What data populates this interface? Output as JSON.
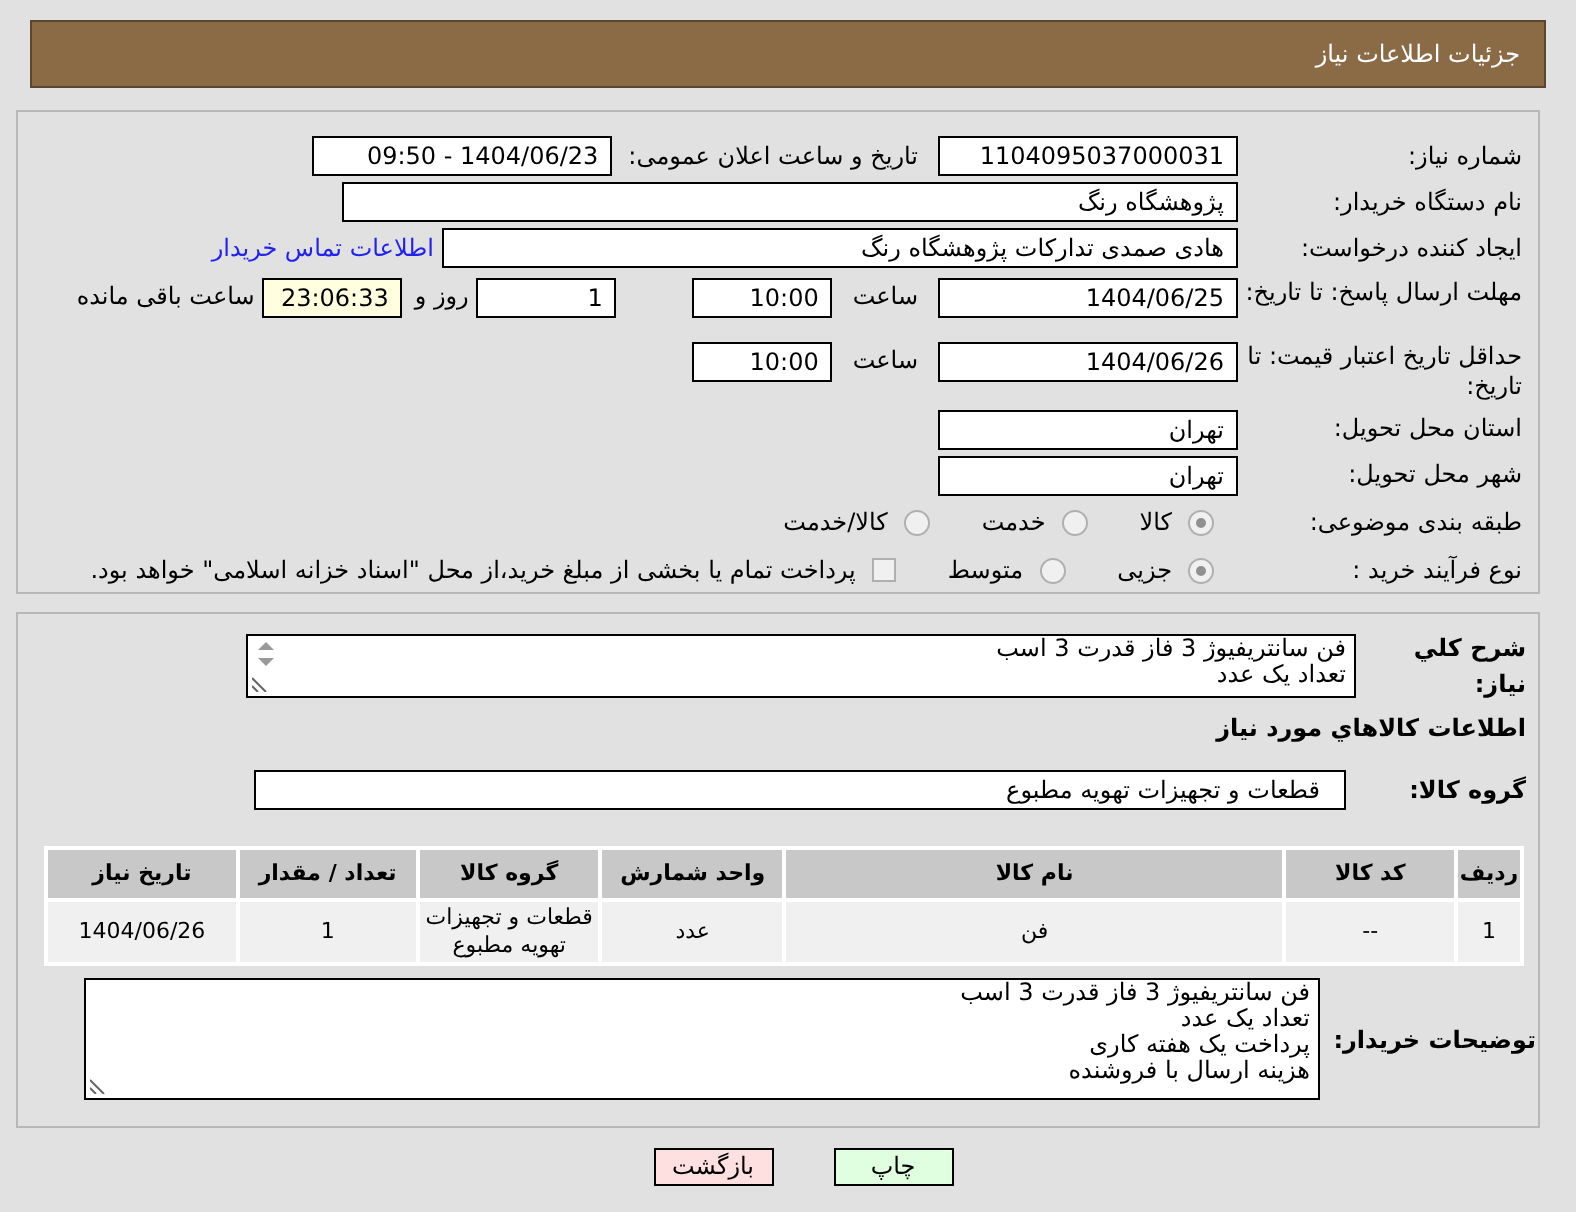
{
  "header": {
    "title": "جزئیات اطلاعات نیاز"
  },
  "need_number": {
    "label": "شماره نیاز:",
    "value": "1104095037000031"
  },
  "announce": {
    "label": "تاریخ و ساعت اعلان عمومی:",
    "value": "1404/06/23 - 09:50"
  },
  "buyer": {
    "label": "نام دستگاه خریدار:",
    "value": "پژوهشگاه رنگ"
  },
  "requester": {
    "label": "ایجاد کننده درخواست:",
    "value": "هادی صمدی تدارکات پژوهشگاه رنگ",
    "link": "اطلاعات تماس خریدار"
  },
  "deadline": {
    "label": "مهلت ارسال پاسخ: تا تاریخ:",
    "date": "1404/06/25",
    "time_label": "ساعت",
    "time": "10:00",
    "days": "1",
    "days_label": "روز و",
    "remaining": "23:06:33",
    "remaining_label": "ساعت باقی مانده"
  },
  "validity": {
    "label": "حداقل تاریخ اعتبار قیمت: تا تاریخ:",
    "date": "1404/06/26",
    "time_label": "ساعت",
    "time": "10:00"
  },
  "province": {
    "label": "استان محل تحویل:",
    "value": "تهران"
  },
  "city": {
    "label": "شهر محل تحویل:",
    "value": "تهران"
  },
  "category": {
    "label": "طبقه بندی موضوعی:",
    "options": [
      {
        "label": "کالا",
        "selected": true
      },
      {
        "label": "خدمت",
        "selected": false
      },
      {
        "label": "کالا/خدمت",
        "selected": false
      }
    ]
  },
  "process": {
    "label": "نوع فرآیند خرید :",
    "options": [
      {
        "label": "جزیی",
        "selected": true
      },
      {
        "label": "متوسط",
        "selected": false
      }
    ],
    "treasury": {
      "label": "پرداخت تمام یا بخشی از مبلغ خرید،از محل \"اسناد خزانه اسلامی\" خواهد بود.",
      "checked": false
    }
  },
  "description": {
    "label": "شرح کلي نياز:",
    "lines": [
      "فن سانتریفیوژ 3 فاز قدرت 3 اسب",
      "تعداد یک عدد"
    ]
  },
  "goods_heading": "اطلاعات کالاهاي مورد نياز",
  "goods_group": {
    "label": "گروه کالا:",
    "value": "قطعات و تجهیزات تهویه مطبوع"
  },
  "table": {
    "columns": [
      "رديف",
      "کد کالا",
      "نام کالا",
      "واحد شمارش",
      "گروه کالا",
      "تعداد / مقدار",
      "تاریخ نیاز"
    ],
    "rows": [
      [
        "1",
        "--",
        "فن",
        "عدد",
        "قطعات و تجهیزات تهویه مطبوع",
        "1",
        "1404/06/26"
      ]
    ]
  },
  "buyer_notes": {
    "label": "توضیحات خریدار:",
    "lines": [
      "فن سانتریفیوژ 3 فاز قدرت 3 اسب",
      "تعداد یک عدد",
      "پرداخت یک هفته کاری",
      "هزینه ارسال با فروشنده"
    ]
  },
  "buttons": [
    {
      "label": "چاپ",
      "kind": "print"
    },
    {
      "label": "بازگشت",
      "kind": "back"
    }
  ]
}
